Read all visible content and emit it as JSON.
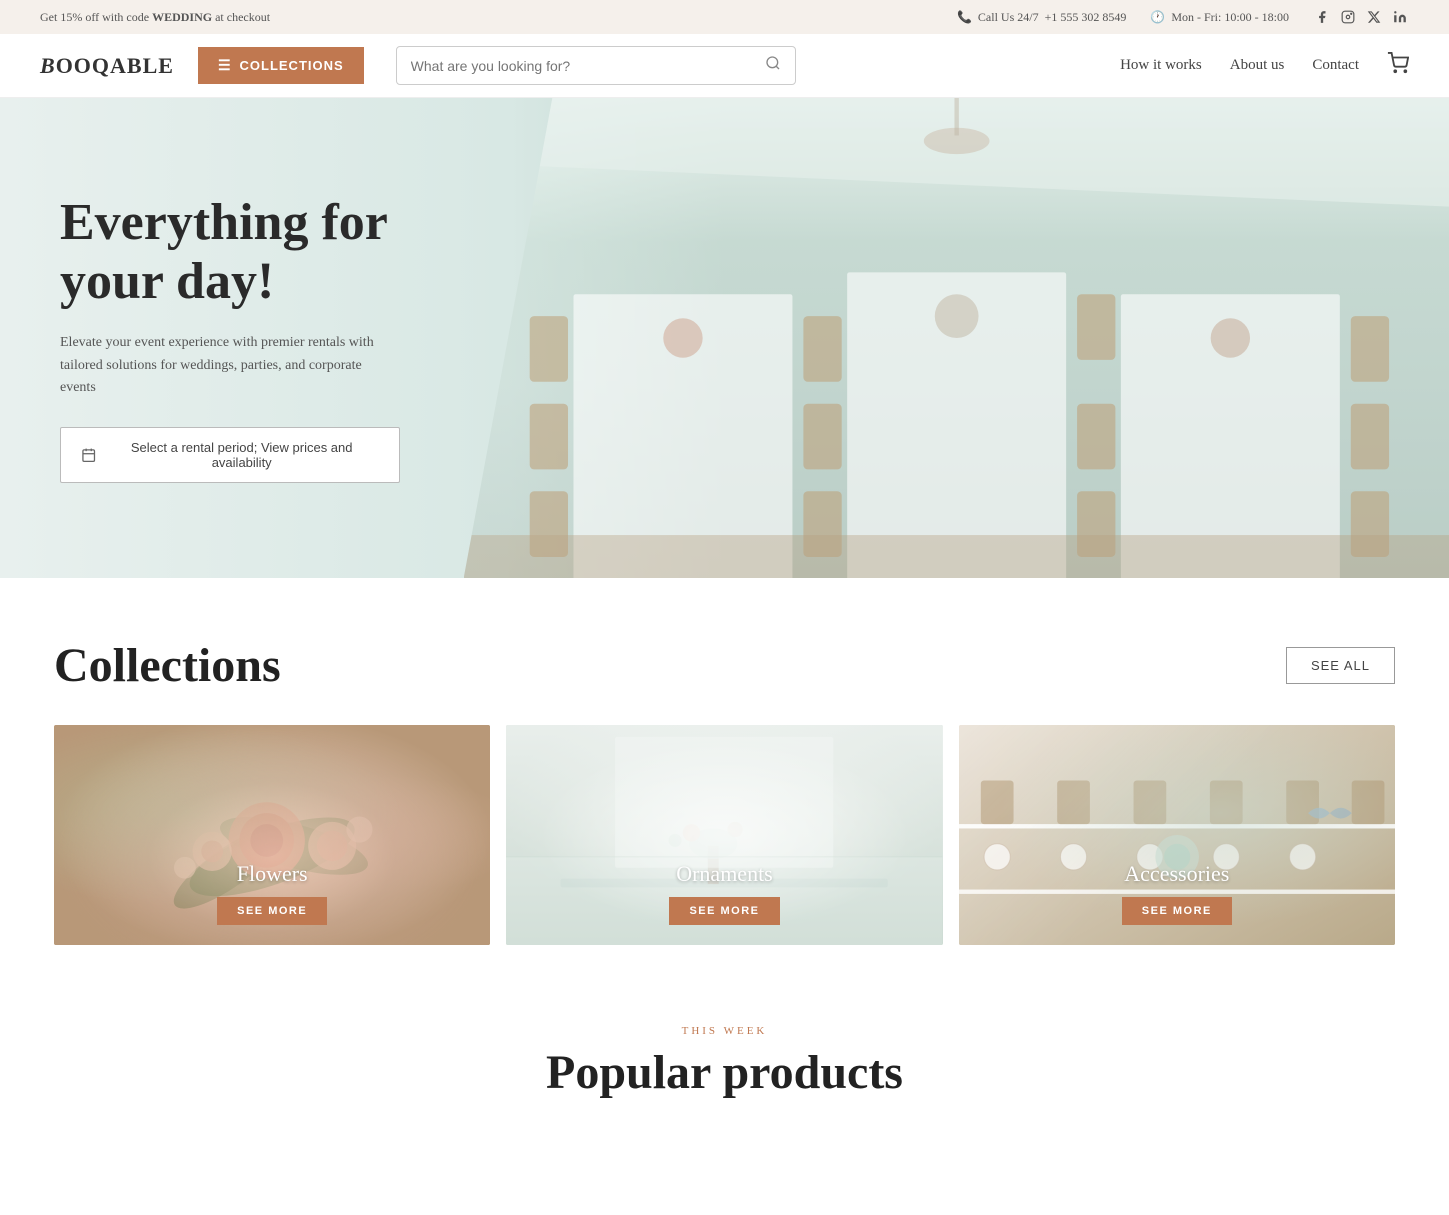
{
  "topbar": {
    "promo": "Get 15% off with code ",
    "promo_code": "WEDDING",
    "promo_suffix": " at checkout",
    "phone_label": "Call Us 24/7",
    "phone_number": "+1 555 302 8549",
    "hours": "Mon - Fri: 10:00 - 18:00",
    "social_icons": [
      "facebook",
      "instagram",
      "twitter-x",
      "linkedin"
    ]
  },
  "header": {
    "logo": "BOOQABLE",
    "collections_btn": "COLLECTIONS",
    "search_placeholder": "What are you looking for?",
    "nav_links": [
      "How it works",
      "About us",
      "Contact"
    ]
  },
  "hero": {
    "title": "Everything for your day!",
    "subtitle": "Elevate your event experience with premier rentals with tailored solutions for weddings, parties, and corporate events",
    "cta": "Select a rental period; View prices and availability"
  },
  "collections": {
    "title": "Collections",
    "see_all": "SEE ALL",
    "items": [
      {
        "name": "Flowers",
        "see_more": "SEE MORE",
        "bg_class": "card-flowers"
      },
      {
        "name": "Ornaments",
        "see_more": "SEE MORE",
        "bg_class": "card-ornaments"
      },
      {
        "name": "Accessories",
        "see_more": "SEE MORE",
        "bg_class": "card-accessories"
      }
    ]
  },
  "this_week": {
    "label": "THIS WEEK",
    "title": "Popular products"
  },
  "colors": {
    "accent": "#c07850",
    "bg_light": "#f5f0eb"
  }
}
